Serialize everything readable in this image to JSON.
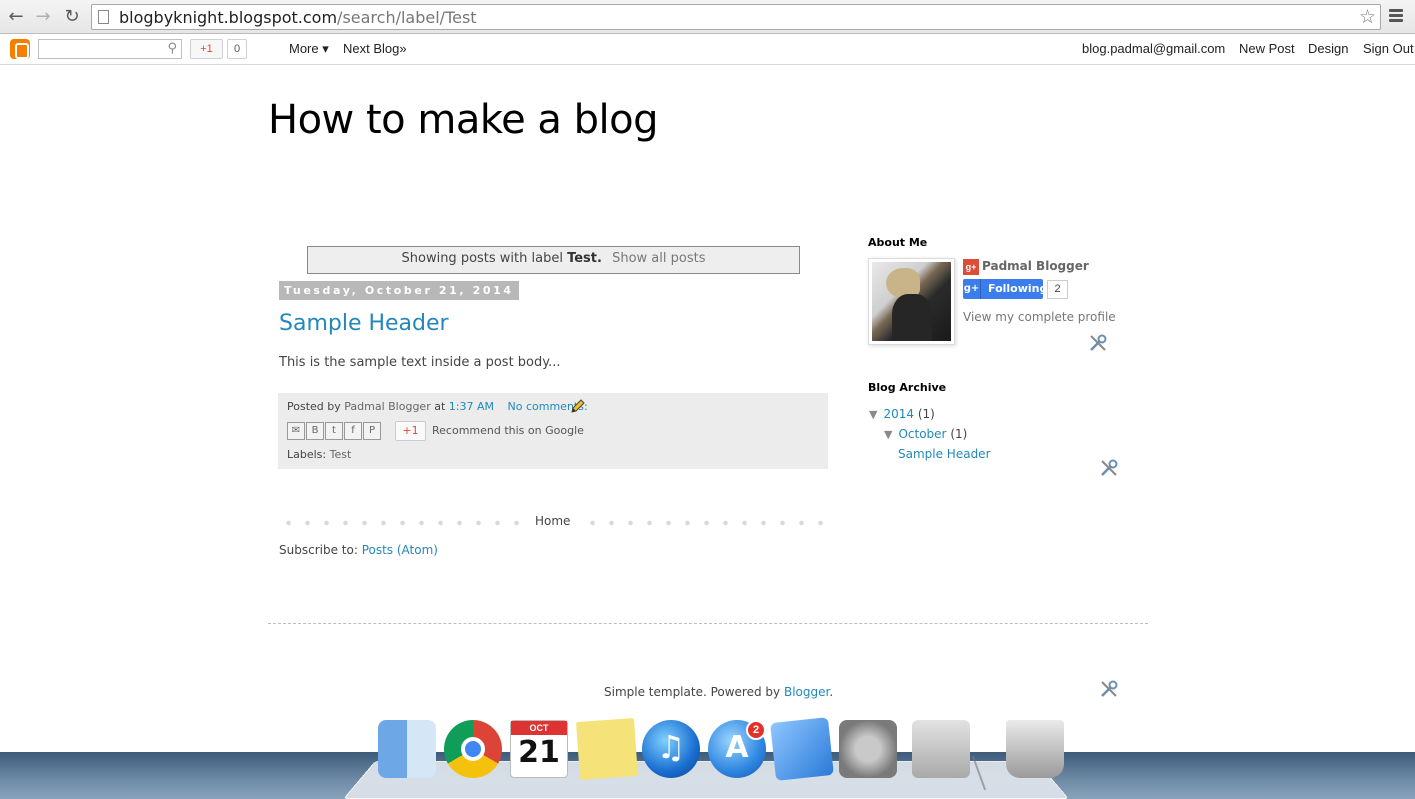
{
  "browser": {
    "url_host": "blogbyknight.blogspot.com",
    "url_path": "/search/label/Test"
  },
  "navbar": {
    "gplus_label": "+1",
    "gplus_count": "0",
    "more_label": "More ▾",
    "next_blog_label": "Next Blog»",
    "account_email": "blog.padmal@gmail.com",
    "new_post_label": "New Post",
    "design_label": "Design",
    "sign_out_label": "Sign Out"
  },
  "blog": {
    "title": "How to make a blog"
  },
  "status": {
    "prefix": "Showing posts with label",
    "label": "Test.",
    "show_all": "Show all posts"
  },
  "post": {
    "date_header": "Tuesday, October 21, 2014",
    "title": "Sample Header",
    "body": "This is the sample text inside a post body...",
    "footer": {
      "posted_by_label": "Posted by",
      "author": "Padmal Blogger",
      "at_label": "at",
      "time": "1:37 AM",
      "comments": "No comments:",
      "share_gplus": "+1",
      "recommend_text": "Recommend this on Google",
      "labels_label": "Labels:",
      "label_value": "Test"
    }
  },
  "pager": {
    "home_label": "Home"
  },
  "subscribe": {
    "label": "Subscribe to:",
    "link": "Posts (Atom)"
  },
  "sidebar": {
    "about_title": "About Me",
    "profile_name": "Padmal Blogger",
    "follow_label": "Following",
    "follow_count": "2",
    "view_profile": "View my complete profile",
    "archive_title": "Blog Archive",
    "archive": {
      "year": "2014",
      "year_count": "(1)",
      "month": "October",
      "month_count": "(1)",
      "post": "Sample Header"
    }
  },
  "footer": {
    "attribution_prefix": "Simple template. Powered by",
    "attribution_link": "Blogger",
    "attribution_suffix": "."
  },
  "dock": {
    "calendar_month": "OCT",
    "calendar_day": "21",
    "appstore_badge": "2"
  }
}
